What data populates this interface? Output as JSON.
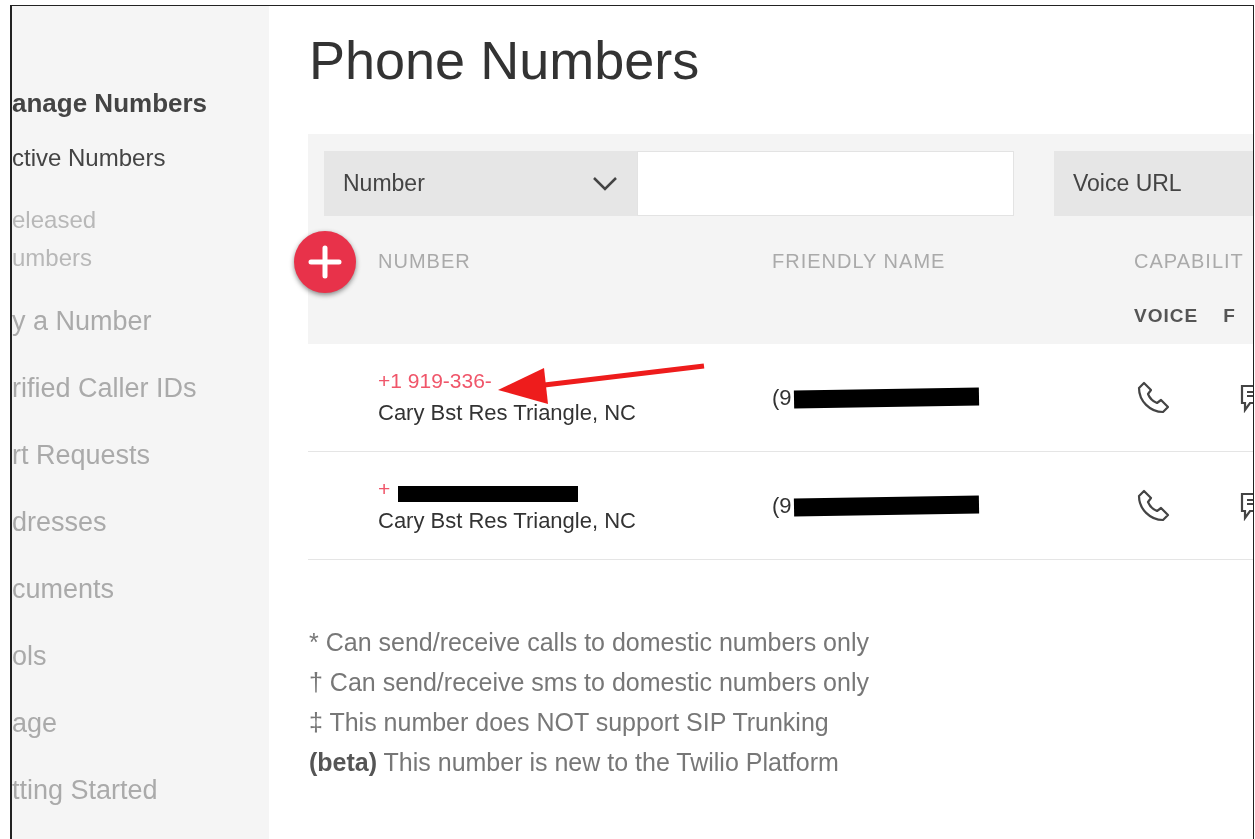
{
  "sidebar": {
    "heading": "anage Numbers",
    "items": [
      {
        "lines": [
          "ctive Numbers"
        ],
        "selected": true,
        "kind": "sub"
      },
      {
        "lines": [
          "eleased",
          "umbers"
        ],
        "selected": false,
        "kind": "sub"
      },
      {
        "lines": [
          "y a Number"
        ],
        "selected": false,
        "kind": "main"
      },
      {
        "lines": [
          "rified Caller IDs"
        ],
        "selected": false,
        "kind": "main"
      },
      {
        "lines": [
          "rt Requests"
        ],
        "selected": false,
        "kind": "main"
      },
      {
        "lines": [
          "dresses"
        ],
        "selected": false,
        "kind": "main"
      },
      {
        "lines": [
          "cuments"
        ],
        "selected": false,
        "kind": "main"
      },
      {
        "lines": [
          "ols"
        ],
        "selected": false,
        "kind": "main"
      },
      {
        "lines": [
          "age"
        ],
        "selected": false,
        "kind": "main"
      },
      {
        "lines": [
          "tting Started"
        ],
        "selected": false,
        "kind": "main"
      }
    ]
  },
  "title": "Phone Numbers",
  "filters": [
    {
      "kind": "dropdown",
      "label": "Number",
      "chevron": true
    },
    {
      "kind": "input"
    },
    {
      "kind": "dropdown",
      "label": "Voice URL"
    }
  ],
  "table": {
    "columns": [
      "NUMBER",
      "FRIENDLY NAME",
      "CAPABILIT"
    ],
    "subcolumns": [
      "VOICE",
      "F"
    ],
    "rows": [
      {
        "number": "+1 919-336-",
        "number_redacted": false,
        "annotation": {
          "kind": "arrow"
        },
        "location": "Cary Bst Res Triangle, NC",
        "friendly_name": "(9",
        "friendly_redacted": true,
        "voice": true,
        "sms": true
      },
      {
        "number": "+",
        "number_redacted": true,
        "location": "Cary Bst Res Triangle, NC",
        "friendly_name": "(9",
        "friendly_redacted": true,
        "voice": true,
        "sms": true
      }
    ]
  },
  "footnotes": [
    "* Can send/receive calls to domestic numbers only",
    "† Can send/receive sms to domestic numbers only",
    "‡ This number does NOT support SIP Trunking",
    "**(beta)** This number is new to the Twilio Platform"
  ]
}
